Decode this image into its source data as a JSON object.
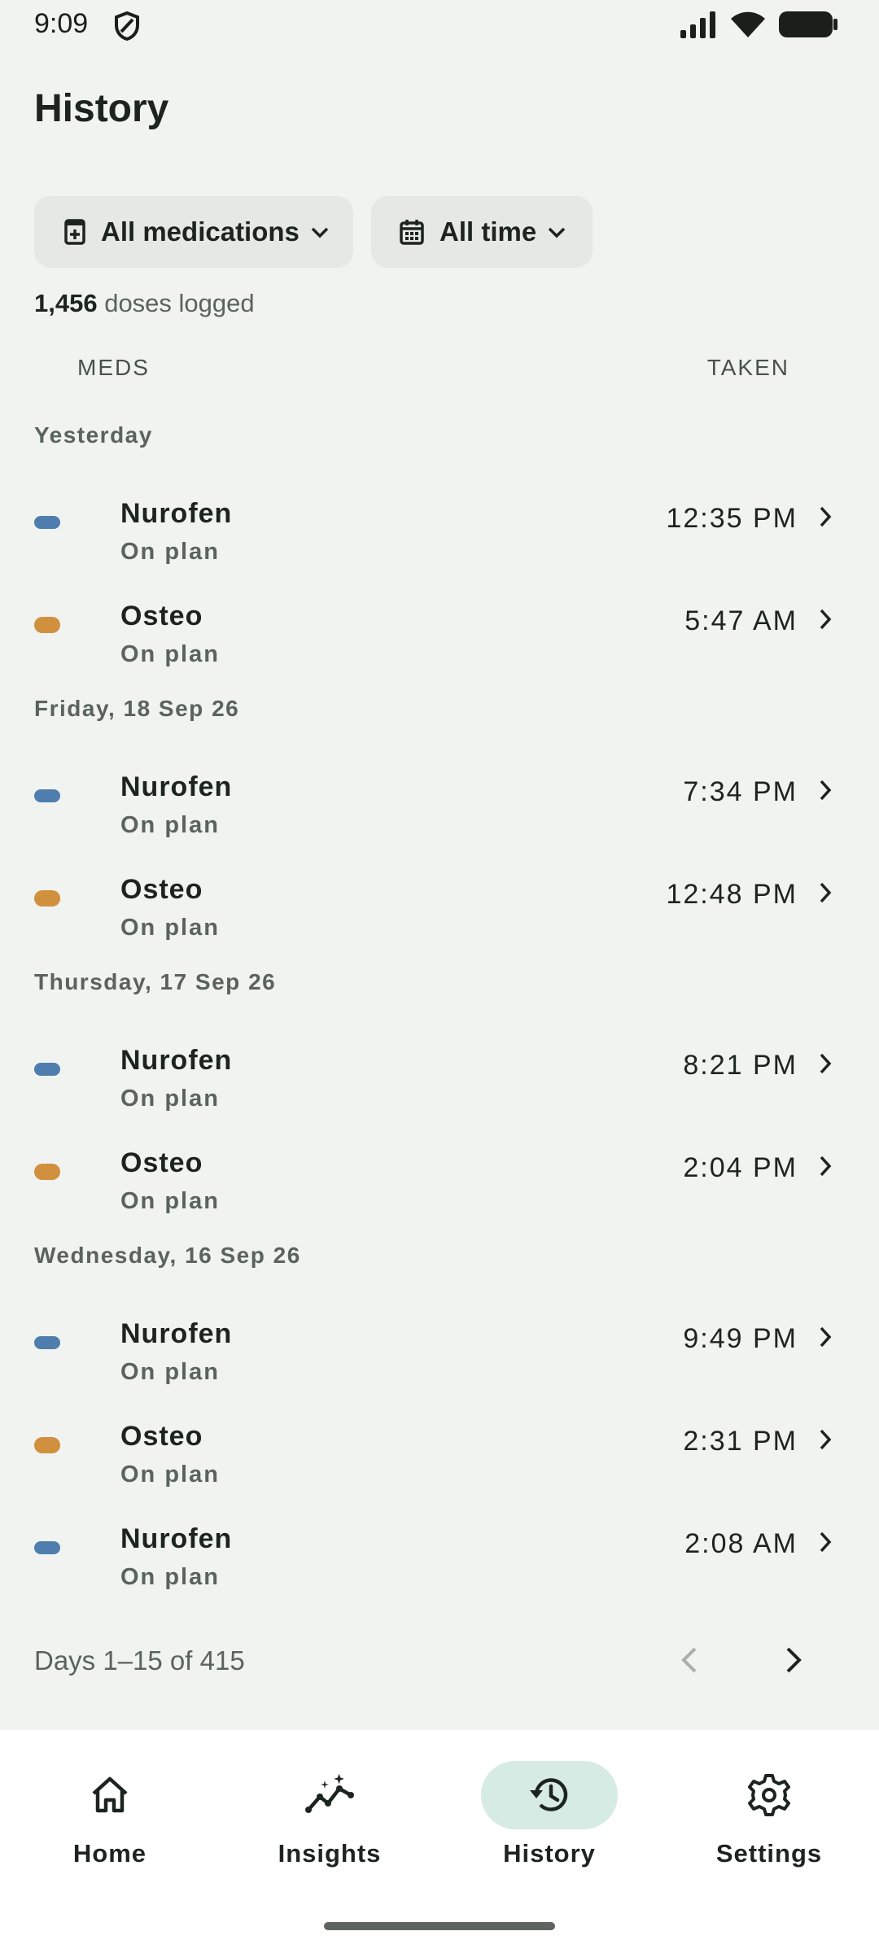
{
  "status_bar": {
    "time": "9:09"
  },
  "header": {
    "title": "History"
  },
  "filters": {
    "medications_label": "All medications",
    "time_label": "All time"
  },
  "summary": {
    "count": "1,456",
    "count_suffix": "doses logged"
  },
  "columns": {
    "meds": "MEDS",
    "taken": "TAKEN"
  },
  "colors": {
    "nurofen": "#4f7eae",
    "osteo": "#d1903e",
    "active_nav_bg": "#d6ebe4",
    "background": "#f1f3f0"
  },
  "days": [
    {
      "label": "Yesterday",
      "entries": [
        {
          "med": "Nurofen",
          "status": "On plan",
          "time": "12:35 PM",
          "pill": "nurofen"
        },
        {
          "med": "Osteo",
          "status": "On plan",
          "time": "5:47 AM",
          "pill": "osteo"
        }
      ]
    },
    {
      "label": "Friday, 18 Sep 26",
      "entries": [
        {
          "med": "Nurofen",
          "status": "On plan",
          "time": "7:34 PM",
          "pill": "nurofen"
        },
        {
          "med": "Osteo",
          "status": "On plan",
          "time": "12:48 PM",
          "pill": "osteo"
        }
      ]
    },
    {
      "label": "Thursday, 17 Sep 26",
      "entries": [
        {
          "med": "Nurofen",
          "status": "On plan",
          "time": "8:21 PM",
          "pill": "nurofen"
        },
        {
          "med": "Osteo",
          "status": "On plan",
          "time": "2:04 PM",
          "pill": "osteo"
        }
      ]
    },
    {
      "label": "Wednesday, 16 Sep 26",
      "entries": [
        {
          "med": "Nurofen",
          "status": "On plan",
          "time": "9:49 PM",
          "pill": "nurofen"
        },
        {
          "med": "Osteo",
          "status": "On plan",
          "time": "2:31 PM",
          "pill": "osteo"
        },
        {
          "med": "Nurofen",
          "status": "On plan",
          "time": "2:08 AM",
          "pill": "nurofen"
        }
      ]
    }
  ],
  "pagination": {
    "label": "Days 1–15 of 415",
    "prev_icon": "chevron-left-icon",
    "next_icon": "chevron-right-icon"
  },
  "bottom_nav": {
    "items": [
      {
        "label": "Home",
        "icon": "home-icon"
      },
      {
        "label": "Insights",
        "icon": "insights-icon"
      },
      {
        "label": "History",
        "icon": "history-icon",
        "active": true
      },
      {
        "label": "Settings",
        "icon": "settings-icon"
      }
    ]
  }
}
